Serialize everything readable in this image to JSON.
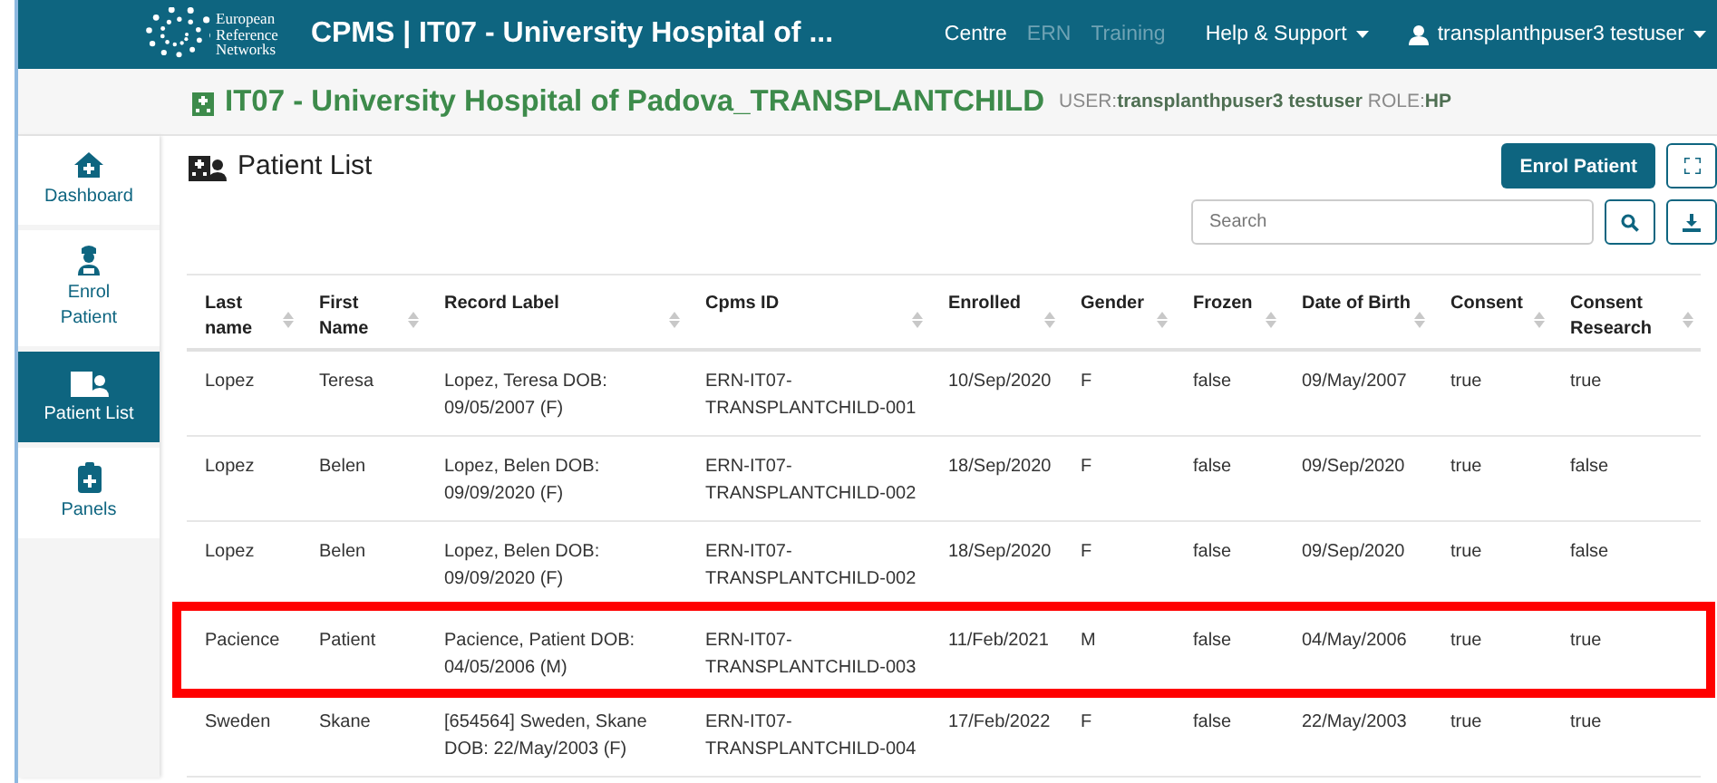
{
  "navbar": {
    "logo_lines": [
      "European",
      "Reference",
      "Networks"
    ],
    "title": "CPMS | IT07 - University Hospital of ...",
    "links": [
      {
        "label": "Centre",
        "disabled": false
      },
      {
        "label": "ERN",
        "disabled": true
      },
      {
        "label": "Training",
        "disabled": true
      }
    ],
    "menus": [
      {
        "label": "Help & Support",
        "kind": "dropdown"
      },
      {
        "label": "transplanthpuser3 testuser",
        "kind": "user"
      }
    ]
  },
  "context": {
    "hospital": "IT07 - University Hospital of Padova_TRANSPLANTCHILD",
    "user_label": "USER:",
    "user": "transplanthpuser3 testuser",
    "role_label": "ROLE:",
    "role": "HP"
  },
  "sidebar": {
    "items": [
      {
        "label": "Dashboard",
        "kind": "home",
        "selected": false
      },
      {
        "label": "Enrol Patient",
        "kind": "nurse",
        "selected": false
      },
      {
        "label": "Patient List",
        "kind": "patients",
        "selected": true
      },
      {
        "label": "Panels",
        "kind": "clipboard",
        "selected": false
      }
    ]
  },
  "page": {
    "title": "Patient List",
    "enrol_button": "Enrol Patient",
    "search": {
      "placeholder": "Search"
    }
  },
  "table": {
    "columns": [
      "Last name",
      "First Name",
      "Record Label",
      "Cpms ID",
      "Enrolled",
      "Gender",
      "Frozen",
      "Date of Birth",
      "Consent",
      "Consent Research"
    ],
    "rows": [
      {
        "highlighted": false,
        "cells": [
          "Lopez",
          "Teresa",
          "Lopez, Teresa DOB: 09/05/2007 (F)",
          "ERN-IT07-TRANSPLANTCHILD-001",
          "10/Sep/2020",
          "F",
          "false",
          "09/May/2007",
          "true",
          "true"
        ]
      },
      {
        "highlighted": false,
        "cells": [
          "Lopez",
          "Belen",
          "Lopez, Belen DOB: 09/09/2020 (F)",
          "ERN-IT07-TRANSPLANTCHILD-002",
          "18/Sep/2020",
          "F",
          "false",
          "09/Sep/2020",
          "true",
          "false"
        ]
      },
      {
        "highlighted": false,
        "cells": [
          "Lopez",
          "Belen",
          "Lopez, Belen DOB: 09/09/2020 (F)",
          "ERN-IT07-TRANSPLANTCHILD-002",
          "18/Sep/2020",
          "F",
          "false",
          "09/Sep/2020",
          "true",
          "false"
        ]
      },
      {
        "highlighted": true,
        "cells": [
          "Pacience",
          "Patient",
          "Pacience, Patient DOB: 04/05/2006 (M)",
          "ERN-IT07-TRANSPLANTCHILD-003",
          "11/Feb/2021",
          "M",
          "false",
          "04/May/2006",
          "true",
          "true"
        ]
      },
      {
        "highlighted": false,
        "cells": [
          "Sweden",
          "Skane",
          "[654564] Sweden, Skane DOB: 22/May/2003 (F)",
          "ERN-IT07-TRANSPLANTCHILD-004",
          "17/Feb/2022",
          "F",
          "false",
          "22/May/2003",
          "true",
          "true"
        ]
      }
    ]
  }
}
